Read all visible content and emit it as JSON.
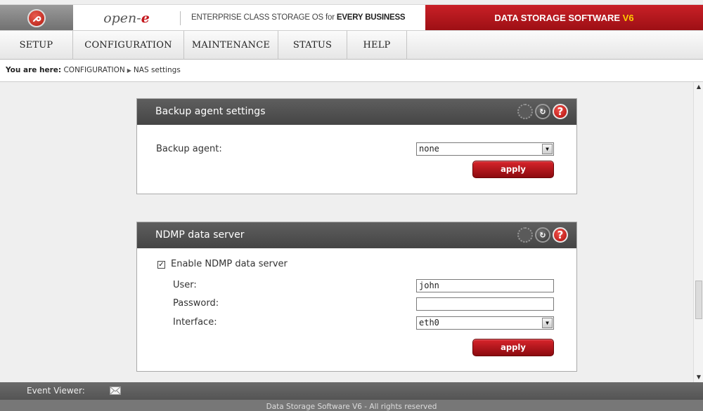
{
  "header": {
    "brand_prefix": "open-",
    "brand_suffix": "e",
    "tagline_prefix": "ENTERPRISE CLASS STORAGE OS for ",
    "tagline_bold": "EVERY BUSINESS",
    "product_main": "DATA STORAGE SOFTWARE ",
    "product_version": "V6",
    "accent_color": "#c4161c",
    "logo_icon": "wrench-icon"
  },
  "nav": {
    "items": [
      {
        "label": "SETUP"
      },
      {
        "label": "CONFIGURATION"
      },
      {
        "label": "MAINTENANCE"
      },
      {
        "label": "STATUS"
      },
      {
        "label": "HELP"
      }
    ]
  },
  "breadcrumb": {
    "prefix": "You are here:",
    "section": "CONFIGURATION",
    "page": "NAS settings"
  },
  "backup_panel": {
    "title": "Backup agent settings",
    "agent_label": "Backup agent:",
    "agent_value": "none",
    "apply_label": "apply"
  },
  "ndmp_panel": {
    "title": "NDMP data server",
    "enable_label": "Enable NDMP data server",
    "enable_checked": "☑",
    "user_label": "User:",
    "user_value": "john",
    "password_label": "Password:",
    "password_value": "",
    "interface_label": "Interface:",
    "interface_value": "eth0",
    "apply_label": "apply"
  },
  "footer": {
    "event_viewer_label": "Event Viewer:",
    "copyright": "Data Storage Software V6 - All rights reserved"
  }
}
